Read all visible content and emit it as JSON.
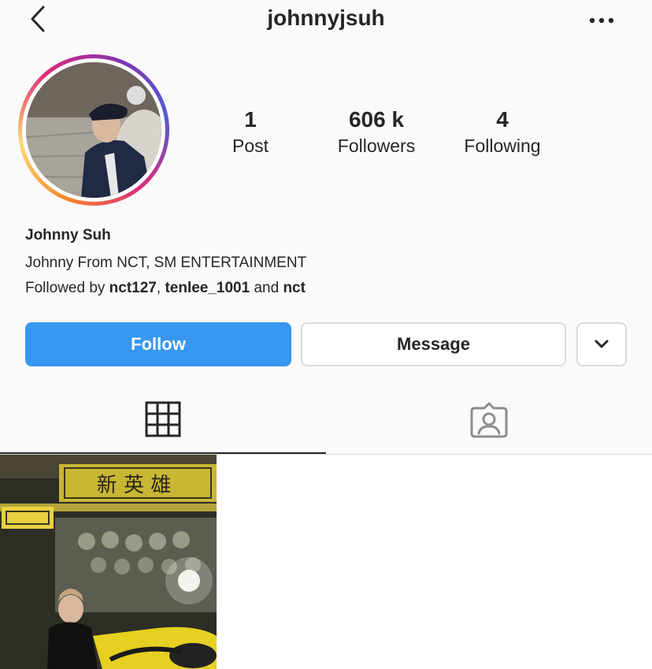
{
  "header": {
    "username": "johnnyjsuh"
  },
  "stats": [
    {
      "value": "1",
      "label": "Post"
    },
    {
      "value": "606 k",
      "label": "Followers"
    },
    {
      "value": "4",
      "label": "Following"
    }
  ],
  "bio": {
    "name": "Johnny Suh",
    "description": "Johnny From NCT, SM ENTERTAINMENT",
    "followed_prefix": "Followed by ",
    "followed_user1": "nct127",
    "followed_sep": ", ",
    "followed_user2": "tenlee_1001",
    "followed_and": " and ",
    "followed_user3": "nct"
  },
  "buttons": {
    "follow": "Follow",
    "message": "Message"
  },
  "post": {
    "sign_text": "新 英 雄"
  },
  "colors": {
    "follow_blue": "#3897f0",
    "text": "#262626",
    "border": "#dbdbdb"
  },
  "icons": [
    "back-chevron-icon",
    "more-dots-icon",
    "chevron-down-icon",
    "grid-icon",
    "tagged-user-icon"
  ]
}
